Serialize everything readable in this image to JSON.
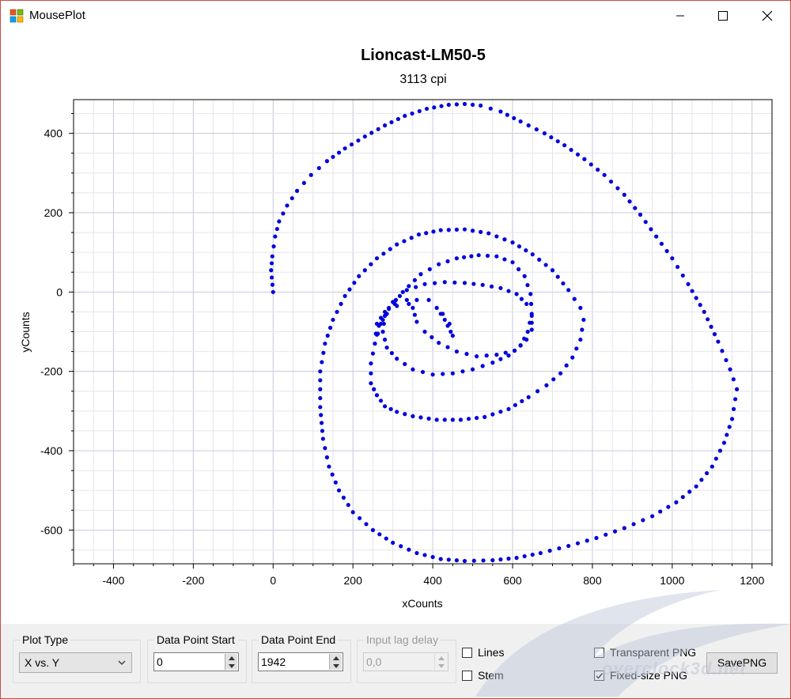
{
  "window": {
    "title": "MousePlot",
    "controls": {
      "minimize": "minimize",
      "maximize": "maximize",
      "close": "close"
    }
  },
  "chart_data": {
    "type": "scatter",
    "title": "Lioncast-LM50-5",
    "subtitle": "3113 cpi",
    "xlabel": "xCounts",
    "ylabel": "yCounts",
    "xlim": [
      -500,
      1250
    ],
    "ylim": [
      -685,
      485
    ],
    "x_ticks": [
      -400,
      -200,
      0,
      200,
      400,
      600,
      800,
      1000,
      1200
    ],
    "y_ticks": [
      400,
      200,
      0,
      -200,
      -400,
      -600
    ],
    "grid": true,
    "marker_color": "#0000dd",
    "points": [
      [
        0,
        0
      ],
      [
        -5,
        55
      ],
      [
        -2,
        90
      ],
      [
        5,
        140
      ],
      [
        15,
        178
      ],
      [
        35,
        218
      ],
      [
        60,
        255
      ],
      [
        95,
        295
      ],
      [
        135,
        330
      ],
      [
        180,
        362
      ],
      [
        230,
        392
      ],
      [
        280,
        420
      ],
      [
        330,
        444
      ],
      [
        385,
        462
      ],
      [
        440,
        472
      ],
      [
        480,
        474
      ],
      [
        520,
        470
      ],
      [
        570,
        455
      ],
      [
        620,
        430
      ],
      [
        680,
        400
      ],
      [
        730,
        370
      ],
      [
        780,
        335
      ],
      [
        830,
        295
      ],
      [
        880,
        245
      ],
      [
        920,
        195
      ],
      [
        960,
        140
      ],
      [
        1000,
        85
      ],
      [
        1040,
        20
      ],
      [
        1080,
        -50
      ],
      [
        1115,
        -125
      ],
      [
        1145,
        -195
      ],
      [
        1162,
        -245
      ],
      [
        1150,
        -320
      ],
      [
        1130,
        -380
      ],
      [
        1100,
        -440
      ],
      [
        1060,
        -490
      ],
      [
        1010,
        -530
      ],
      [
        950,
        -565
      ],
      [
        880,
        -595
      ],
      [
        810,
        -620
      ],
      [
        740,
        -640
      ],
      [
        670,
        -658
      ],
      [
        610,
        -670
      ],
      [
        550,
        -676
      ],
      [
        480,
        -678
      ],
      [
        420,
        -673
      ],
      [
        360,
        -658
      ],
      [
        300,
        -632
      ],
      [
        250,
        -600
      ],
      [
        200,
        -555
      ],
      [
        165,
        -500
      ],
      [
        140,
        -440
      ],
      [
        125,
        -370
      ],
      [
        118,
        -290
      ],
      [
        118,
        -200
      ],
      [
        130,
        -130
      ],
      [
        150,
        -70
      ],
      [
        180,
        -10
      ],
      [
        215,
        40
      ],
      [
        260,
        85
      ],
      [
        310,
        120
      ],
      [
        365,
        145
      ],
      [
        420,
        156
      ],
      [
        480,
        158
      ],
      [
        540,
        148
      ],
      [
        600,
        125
      ],
      [
        650,
        95
      ],
      [
        700,
        55
      ],
      [
        740,
        5
      ],
      [
        770,
        -40
      ],
      [
        778,
        -70
      ],
      [
        770,
        -120
      ],
      [
        750,
        -165
      ],
      [
        720,
        -205
      ],
      [
        685,
        -235
      ],
      [
        640,
        -265
      ],
      [
        590,
        -295
      ],
      [
        530,
        -315
      ],
      [
        470,
        -322
      ],
      [
        410,
        -322
      ],
      [
        350,
        -313
      ],
      [
        310,
        -302
      ],
      [
        280,
        -288
      ],
      [
        260,
        -260
      ],
      [
        245,
        -230
      ],
      [
        245,
        -180
      ],
      [
        255,
        -130
      ],
      [
        270,
        -80
      ],
      [
        290,
        -40
      ],
      [
        325,
        0
      ],
      [
        370,
        45
      ],
      [
        415,
        70
      ],
      [
        460,
        85
      ],
      [
        515,
        93
      ],
      [
        560,
        90
      ],
      [
        600,
        75
      ],
      [
        630,
        40
      ],
      [
        645,
        -5
      ],
      [
        648,
        -55
      ],
      [
        638,
        -100
      ],
      [
        620,
        -135
      ],
      [
        590,
        -160
      ],
      [
        550,
        -178
      ],
      [
        500,
        -195
      ],
      [
        450,
        -205
      ],
      [
        400,
        -208
      ],
      [
        350,
        -195
      ],
      [
        310,
        -168
      ],
      [
        285,
        -140
      ],
      [
        275,
        -100
      ],
      [
        280,
        -60
      ],
      [
        300,
        -25
      ],
      [
        335,
        5
      ],
      [
        380,
        20
      ],
      [
        430,
        25
      ],
      [
        480,
        23
      ],
      [
        525,
        18
      ],
      [
        570,
        10
      ],
      [
        610,
        -5
      ],
      [
        635,
        -30
      ],
      [
        648,
        -60
      ],
      [
        648,
        -95
      ],
      [
        635,
        -120
      ],
      [
        605,
        -148
      ],
      [
        560,
        -158
      ],
      [
        510,
        -162
      ],
      [
        460,
        -150
      ],
      [
        415,
        -128
      ],
      [
        380,
        -100
      ],
      [
        360,
        -75
      ],
      [
        350,
        -40
      ],
      [
        335,
        -20
      ],
      [
        305,
        -30
      ],
      [
        280,
        -50
      ],
      [
        260,
        -80
      ],
      [
        255,
        -130
      ],
      [
        265,
        -85
      ],
      [
        285,
        -55
      ],
      [
        310,
        -35
      ],
      [
        340,
        -30
      ],
      [
        360,
        -20
      ],
      [
        390,
        -20
      ],
      [
        410,
        -40
      ],
      [
        430,
        -70
      ],
      [
        445,
        -100
      ],
      [
        450,
        -110
      ],
      [
        442,
        -80
      ],
      [
        425,
        -55
      ]
    ]
  },
  "controls": {
    "plot_type": {
      "label": "Plot Type",
      "value": "X vs. Y"
    },
    "data_point_start": {
      "label": "Data Point Start",
      "value": "0"
    },
    "data_point_end": {
      "label": "Data Point End",
      "value": "1942"
    },
    "input_lag_delay": {
      "label": "Input lag delay",
      "value": "0,0"
    },
    "lines": {
      "label": "Lines",
      "checked": false
    },
    "stem": {
      "label": "Stem",
      "checked": false
    },
    "transparent_png": {
      "label": "Transparent PNG",
      "checked": false
    },
    "fixed_size_png": {
      "label": "Fixed-size PNG",
      "checked": true
    },
    "save_button": {
      "label": "SavePNG"
    }
  },
  "watermark": {
    "text": "overclock3d.net"
  }
}
